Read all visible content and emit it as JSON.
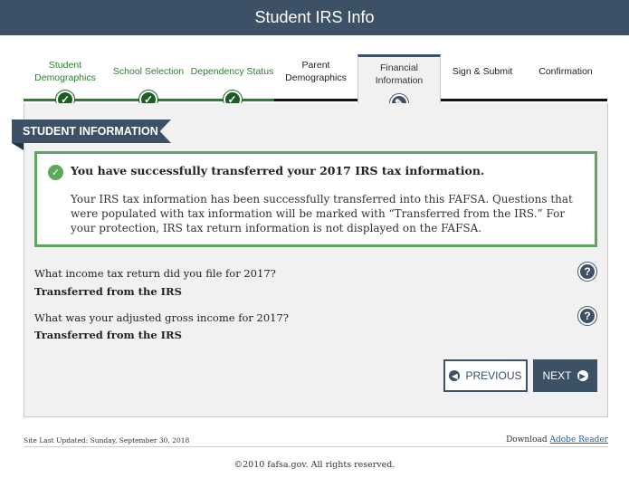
{
  "header": {
    "title": "Student IRS Info"
  },
  "steps": [
    {
      "label": "Student Demographics",
      "state": "done"
    },
    {
      "label": "School Selection",
      "state": "done"
    },
    {
      "label": "Dependency Status",
      "state": "done"
    },
    {
      "label": "Parent Demographics",
      "state": "todo"
    },
    {
      "label": "Financial Information",
      "state": "active"
    },
    {
      "label": "Sign & Submit",
      "state": "todo"
    },
    {
      "label": "Confirmation",
      "state": "todo"
    }
  ],
  "section": {
    "title": "STUDENT INFORMATION"
  },
  "alert": {
    "title": "You have successfully transferred your 2017 IRS tax information.",
    "body": "Your IRS tax information has been successfully transferred into this FAFSA. Questions that were populated with tax information will be marked with “Transferred from the IRS.” For your protection, IRS tax return information is not displayed on the FAFSA."
  },
  "questions": [
    {
      "question": "What income tax return did you file for 2017?",
      "answer": "Transferred from the IRS"
    },
    {
      "question": "What was your adjusted gross income for 2017?",
      "answer": "Transferred from the IRS"
    }
  ],
  "buttons": {
    "previous": "PREVIOUS",
    "next": "NEXT"
  },
  "footer": {
    "updated": "Site Last Updated: Sunday, September 30, 2018",
    "download_label": "Download",
    "download_link": "Adobe Reader",
    "copyright": "©2010 fafsa.gov. All rights reserved."
  },
  "colors": {
    "primary": "#3d5166",
    "success": "#5da85e",
    "done": "#2e7d32"
  },
  "icons": {
    "done": "checkmark-icon",
    "active": "pencil-icon",
    "help": "question-icon",
    "prev": "arrow-left-icon",
    "next": "arrow-right-icon"
  }
}
